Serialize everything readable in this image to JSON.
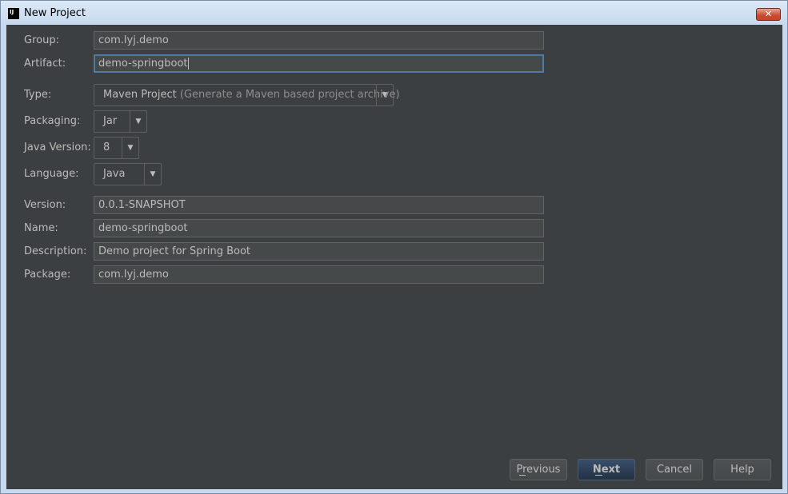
{
  "window": {
    "title": "New Project",
    "app_icon_text": "IJ",
    "close_glyph": "✕"
  },
  "form": {
    "group": {
      "label": "Group:",
      "value": "com.lyj.demo"
    },
    "artifact": {
      "label": "Artifact:",
      "value": "demo-springboot"
    },
    "type": {
      "label": "Type:",
      "value": "Maven Project",
      "hint": "(Generate a Maven based project archive)"
    },
    "packaging": {
      "label": "Packaging:",
      "value": "Jar"
    },
    "java_version": {
      "label": "Java Version:",
      "value": "8"
    },
    "language": {
      "label": "Language:",
      "value": "Java"
    },
    "version": {
      "label": "Version:",
      "value": "0.0.1-SNAPSHOT"
    },
    "name": {
      "label": "Name:",
      "value": "demo-springboot"
    },
    "description": {
      "label": "Description:",
      "value": "Demo project for Spring Boot"
    },
    "package": {
      "label": "Package:",
      "value": "com.lyj.demo"
    }
  },
  "buttons": {
    "previous": "Previous",
    "next": "Next",
    "cancel": "Cancel",
    "help": "Help"
  },
  "icons": {
    "dropdown_arrow": "▼"
  },
  "colors": {
    "background": "#3c3f41",
    "field_background": "#45494a",
    "text": "#bbbbbb",
    "focus_border": "#4f7aa4",
    "default_button": "#2f4258"
  }
}
